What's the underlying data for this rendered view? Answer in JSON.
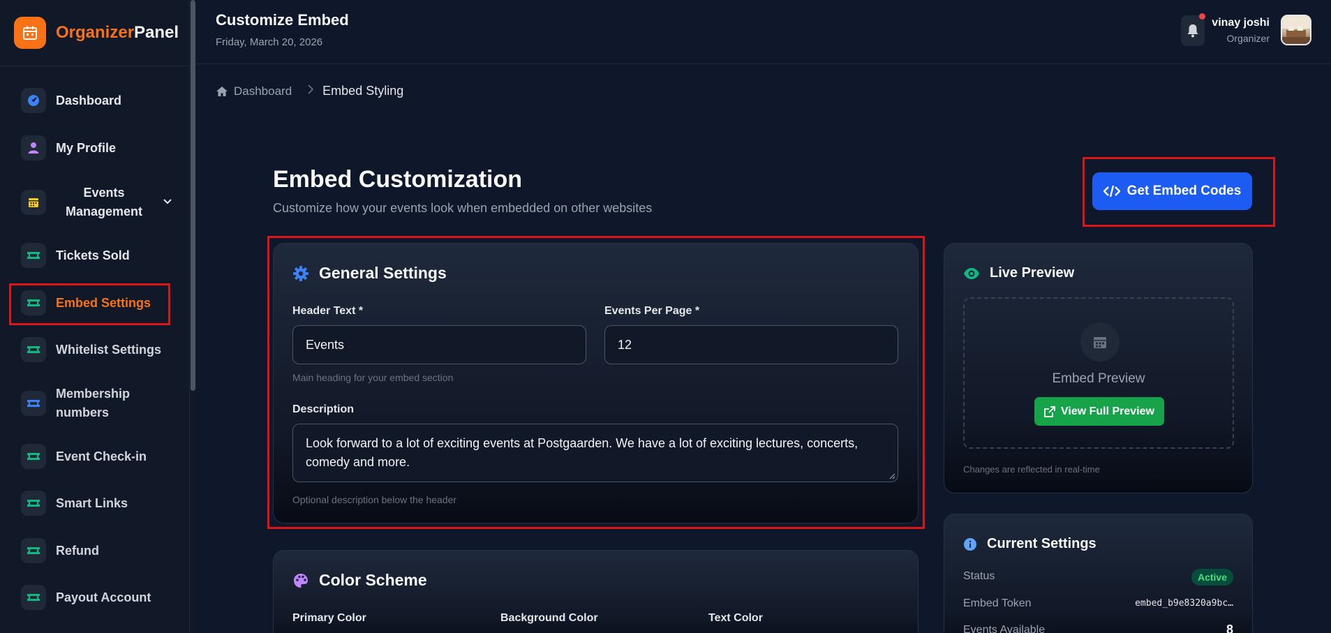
{
  "brand": {
    "part1": "Organizer",
    "part2": "Panel"
  },
  "sidebar": {
    "items": [
      {
        "label": "Dashboard",
        "icon": "dashboard-icon"
      },
      {
        "label": "My Profile",
        "icon": "user-icon"
      },
      {
        "label": "Events Management",
        "icon": "calendar-icon"
      },
      {
        "label": "Tickets Sold",
        "icon": "ticket-icon"
      },
      {
        "label": "Embed Settings",
        "icon": "ticket-icon"
      },
      {
        "label": "Whitelist Settings",
        "icon": "ticket-icon"
      },
      {
        "label": "Membership numbers",
        "icon": "ticket-icon"
      },
      {
        "label": "Event Check-in",
        "icon": "ticket-icon"
      },
      {
        "label": "Smart Links",
        "icon": "ticket-icon"
      },
      {
        "label": "Refund",
        "icon": "ticket-icon"
      },
      {
        "label": "Payout Account",
        "icon": "ticket-icon"
      }
    ]
  },
  "header": {
    "title": "Customize Embed",
    "date": "Friday, March 20, 2026",
    "user_name": "vinay joshi",
    "user_role": "Organizer"
  },
  "breadcrumb": {
    "home": "Dashboard",
    "current": "Embed Styling"
  },
  "main": {
    "heading": "Embed Customization",
    "subheading": "Customize how your events look when embedded on other websites",
    "embed_button": "Get Embed Codes"
  },
  "general": {
    "title": "General Settings",
    "header_text_label": "Header Text *",
    "header_text_value": "Events",
    "header_text_hint": "Main heading for your embed section",
    "events_per_page_label": "Events Per Page *",
    "events_per_page_value": "12",
    "description_label": "Description",
    "description_value": "Look forward to a lot of exciting events at Postgaarden. We have a lot of exciting lectures, concerts, comedy and more.",
    "description_hint": "Optional description below the header"
  },
  "color_scheme": {
    "title": "Color Scheme",
    "primary_label": "Primary Color",
    "background_label": "Background Color",
    "text_label": "Text Color"
  },
  "live_preview": {
    "title": "Live Preview",
    "placeholder": "Embed Preview",
    "button": "View Full Preview",
    "note": "Changes are reflected in real-time"
  },
  "current_settings": {
    "title": "Current Settings",
    "status_label": "Status",
    "status_value": "Active",
    "token_label": "Embed Token",
    "token_value": "embed_b9e8320a9bc…",
    "events_label": "Events Available",
    "events_value": "8"
  },
  "colors": {
    "accent_orange": "#f97316",
    "primary_blue": "#1d5cf2",
    "success_green": "#16a34a",
    "highlight_red": "#dc1616"
  }
}
